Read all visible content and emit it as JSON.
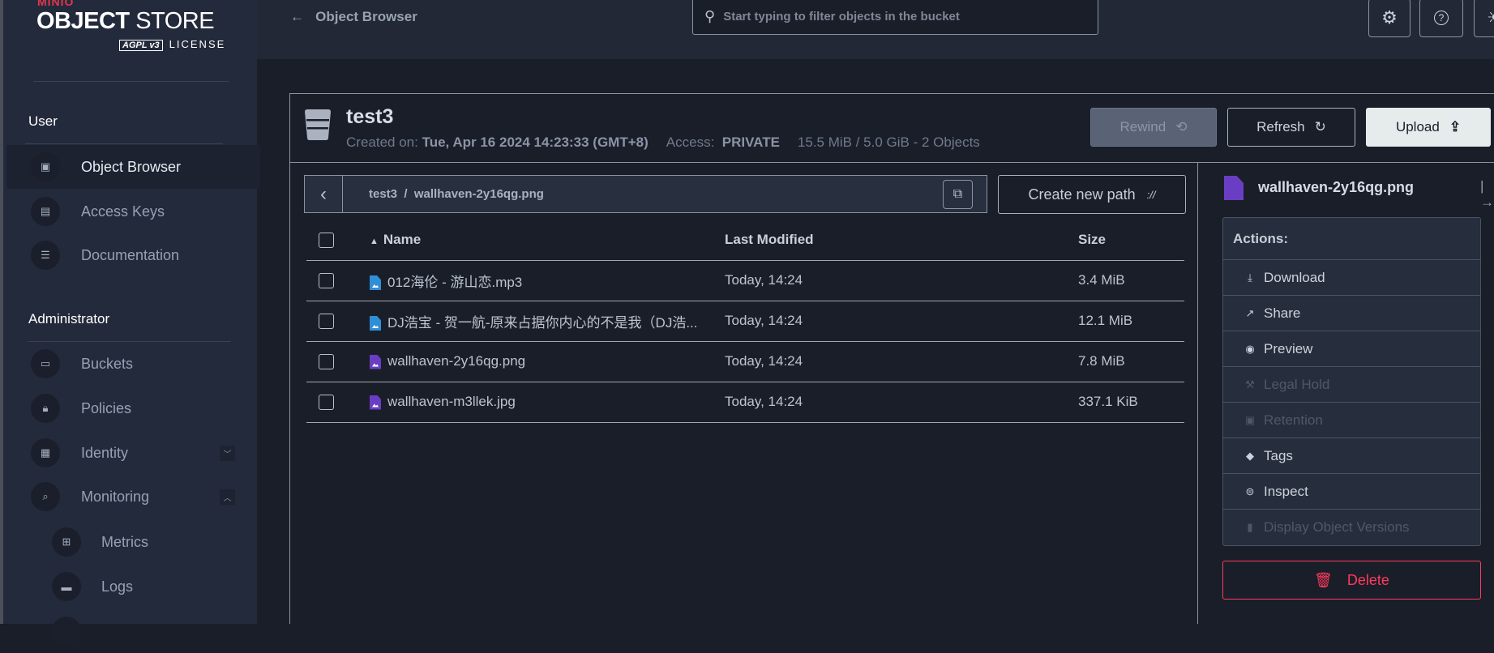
{
  "logo": {
    "brand": "MINIO",
    "product_bold": "OBJECT",
    "product": "STORE",
    "badge": "AGPL v3",
    "license": "LICENSE"
  },
  "sidebar": {
    "user_section": "User",
    "user_items": [
      {
        "label": "Object Browser",
        "icon": "object-browser-icon",
        "active": true
      },
      {
        "label": "Access Keys",
        "icon": "access-keys-icon"
      },
      {
        "label": "Documentation",
        "icon": "documentation-icon"
      }
    ],
    "admin_section": "Administrator",
    "admin_items": [
      {
        "label": "Buckets",
        "icon": "bucket-icon"
      },
      {
        "label": "Policies",
        "icon": "policy-lock-icon"
      },
      {
        "label": "Identity",
        "icon": "identity-icon",
        "expanded": false
      },
      {
        "label": "Monitoring",
        "icon": "monitoring-icon",
        "expanded": true
      },
      {
        "label": "Metrics",
        "icon": "metrics-icon"
      },
      {
        "label": "Logs",
        "icon": "logs-icon"
      }
    ]
  },
  "header": {
    "back_label": "Object Browser",
    "search_placeholder": "Start typing to filter objects in the bucket"
  },
  "bucket": {
    "name": "test3",
    "created_label": "Created on:",
    "created": "Tue, Apr 16 2024 14:23:33 (GMT+8)",
    "access_label": "Access:",
    "access": "PRIVATE",
    "usage": "15.5 MiB / 5.0 GiB - 2 Objects",
    "rewind": "Rewind",
    "refresh": "Refresh",
    "upload": "Upload"
  },
  "browser": {
    "path": "test3  /  wallhaven-2y16qg.png",
    "create_path": "Create new path",
    "columns": {
      "name": "Name",
      "modified": "Last Modified",
      "size": "Size"
    },
    "rows": [
      {
        "name": "012海伦 - 游山恋.mp3",
        "type": "audio",
        "modified": "Today, 14:24",
        "size": "3.4 MiB"
      },
      {
        "name": "DJ浩宝 - 贺一航-原来占据你内心的不是我（DJ浩...",
        "type": "audio",
        "modified": "Today, 14:24",
        "size": "12.1 MiB"
      },
      {
        "name": "wallhaven-2y16qg.png",
        "type": "image",
        "modified": "Today, 14:24",
        "size": "7.8 MiB"
      },
      {
        "name": "wallhaven-m3llek.jpg",
        "type": "image",
        "modified": "Today, 14:24",
        "size": "337.1 KiB"
      }
    ]
  },
  "details": {
    "title": "wallhaven-2y16qg.png",
    "actions_title": "Actions:",
    "actions": [
      {
        "label": "Download",
        "icon": "download-icon",
        "enabled": true
      },
      {
        "label": "Share",
        "icon": "share-icon",
        "enabled": true
      },
      {
        "label": "Preview",
        "icon": "eye-icon",
        "enabled": true
      },
      {
        "label": "Legal Hold",
        "icon": "gavel-icon",
        "enabled": false
      },
      {
        "label": "Retention",
        "icon": "calendar-icon",
        "enabled": false
      },
      {
        "label": "Tags",
        "icon": "tag-icon",
        "enabled": true
      },
      {
        "label": "Inspect",
        "icon": "inspect-icon",
        "enabled": true
      },
      {
        "label": "Display Object Versions",
        "icon": "versions-icon",
        "enabled": false
      }
    ],
    "delete": "Delete"
  },
  "colors": {
    "danger": "#ff3a5c",
    "audio": "#2f8ed8",
    "image": "#6a3ec4",
    "brand": "#e3364f"
  }
}
